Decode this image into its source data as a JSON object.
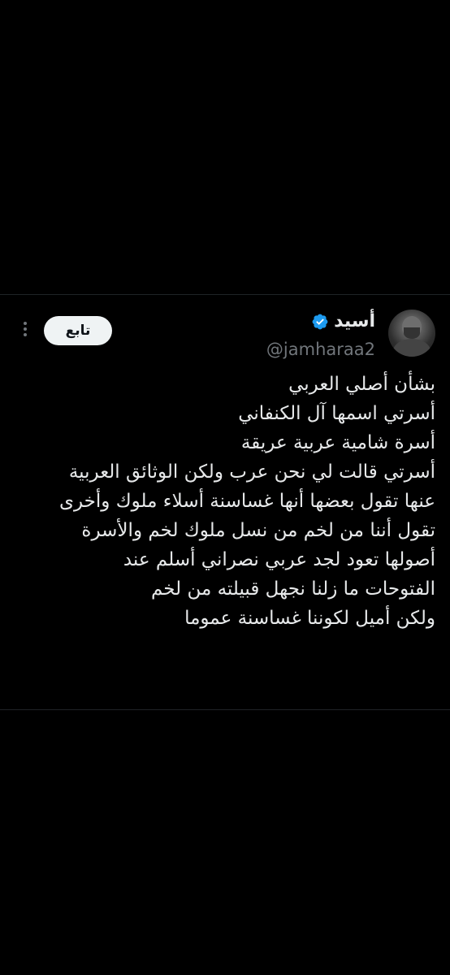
{
  "tweet": {
    "author": {
      "display_name": "أسيد",
      "handle": "@jamharaa2",
      "verified": true,
      "verified_color": "#1d9bf0"
    },
    "follow_label": "تابع",
    "lines": [
      "بشأن أصلي العربي",
      "أسرتي اسمها آل الكنفاني",
      "أسرة شامية عربية عريقة",
      "أسرتي قالت لي نحن عرب ولكن الوثائق العربية",
      "عنها تقول بعضها أنها غساسنة أسلاء ملوك وأخرى",
      "تقول أننا من لخم من نسل ملوك لخم والأسرة",
      "أصولها تعود لجد عربي نصراني أسلم عند",
      "الفتوحات ما زلنا نجهل قبيلته من لخم",
      "ولكن أميل لكوننا غساسنة عموما"
    ]
  }
}
